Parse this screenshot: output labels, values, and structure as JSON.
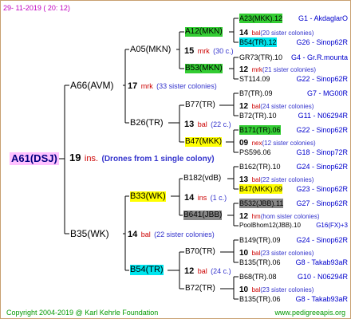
{
  "date": "29- 11-2019 ( 20: 12)",
  "root": {
    "name": "A61(DSJ)",
    "count": "19",
    "subspecies": "ins.",
    "note": "(Drones from 1 single colony)"
  },
  "g1": [
    {
      "name": "A66(AVM)",
      "count": "17",
      "subspecies": "mrk",
      "note": "(33 sister colonies)"
    },
    {
      "name": "B35(WK)",
      "count": "14",
      "subspecies": "bal",
      "note": "(22 sister colonies)"
    }
  ],
  "g2": [
    {
      "name": "A05(MKN)",
      "count": "15",
      "subspecies": "mrk",
      "note": "(30 c.)"
    },
    {
      "name": "B26(TR)",
      "count": "13",
      "subspecies": "bal",
      "note": "(22 c.)"
    },
    {
      "name": "B33(WK)",
      "count": "14",
      "subspecies": "ins",
      "note": "(1 c.)"
    },
    {
      "name": "B54(TR)",
      "count": "12",
      "subspecies": "bal",
      "note": "(24 c.)"
    }
  ],
  "g3": [
    {
      "name": "A12(MKN)",
      "count": "14",
      "subspecies": "bal",
      "note": "(20 sister colonies)"
    },
    {
      "name": "B53(MKN)",
      "count": "12",
      "subspecies": "mrk",
      "note": "(21 sister colonies)"
    },
    {
      "name": "B77(TR)",
      "count": "12",
      "subspecies": "bal",
      "note": "(24 sister colonies)"
    },
    {
      "name": "B47(MKK)",
      "count": "09",
      "subspecies": "nex",
      "note": "(12 sister colonies)"
    },
    {
      "name": "B182(vdB)",
      "count": "13",
      "subspecies": "bal",
      "note": "(22 sister colonies)"
    },
    {
      "name": "B641(JBB)",
      "count": "12",
      "subspecies": "hm",
      "note": "(hom sister colonies)"
    },
    {
      "name": "B70(TR)",
      "count": "10",
      "subspecies": "bal",
      "note": "(23 sister colonies)"
    },
    {
      "name": "B72(TR)",
      "count": "10",
      "subspecies": "bal",
      "note": "(23 sister colonies)"
    }
  ],
  "g4": [
    {
      "name": "A23(MKK).12",
      "right": "G1 - AkdaglarO"
    },
    {
      "name": "B54(TR).12",
      "right": "G26 - Sinop62R"
    },
    {
      "name": "GR73(TR).10",
      "right": "G4 - Gr.R.mounta"
    },
    {
      "name": "ST114.09",
      "right": "G22 - Sinop62R"
    },
    {
      "name": "B7(TR).09",
      "right": "G7 - MG00R"
    },
    {
      "name": "B72(TR).10",
      "right": "G11 - N06294R"
    },
    {
      "name": "B171(TR).06",
      "right": "G22 - Sinop62R"
    },
    {
      "name": "PS596.06",
      "right": "G18 - Sinop72R"
    },
    {
      "name": "B162(TR).10",
      "right": "G24 - Sinop62R"
    },
    {
      "name": "B47(MKK).09",
      "right": "G23 - Sinop62R"
    },
    {
      "name": "B532(JBB).11",
      "right": "G27 - Sinop62R"
    },
    {
      "name": "PoolBhom12(JBB).10",
      "right": "G16(FX)+3"
    },
    {
      "name": "B149(TR).09",
      "right": "G24 - Sinop62R"
    },
    {
      "name": "B135(TR).06",
      "right": "G8 - Takab93aR"
    },
    {
      "name": "B68(TR).08",
      "right": "G10 - N06294R"
    },
    {
      "name": "B135(TR).06",
      "right": "G8 - Takab93aR"
    }
  ],
  "footer": {
    "copyright": "Copyright 2004-2019 @ Karl Kehrle Foundation",
    "url": "www.pedigreeapis.org"
  },
  "colors": {
    "green": "#33cc33",
    "yellow": "#ffff00",
    "cyan": "#00e5ee",
    "gray": "#888888",
    "root_bg": "#ffc0ff"
  }
}
